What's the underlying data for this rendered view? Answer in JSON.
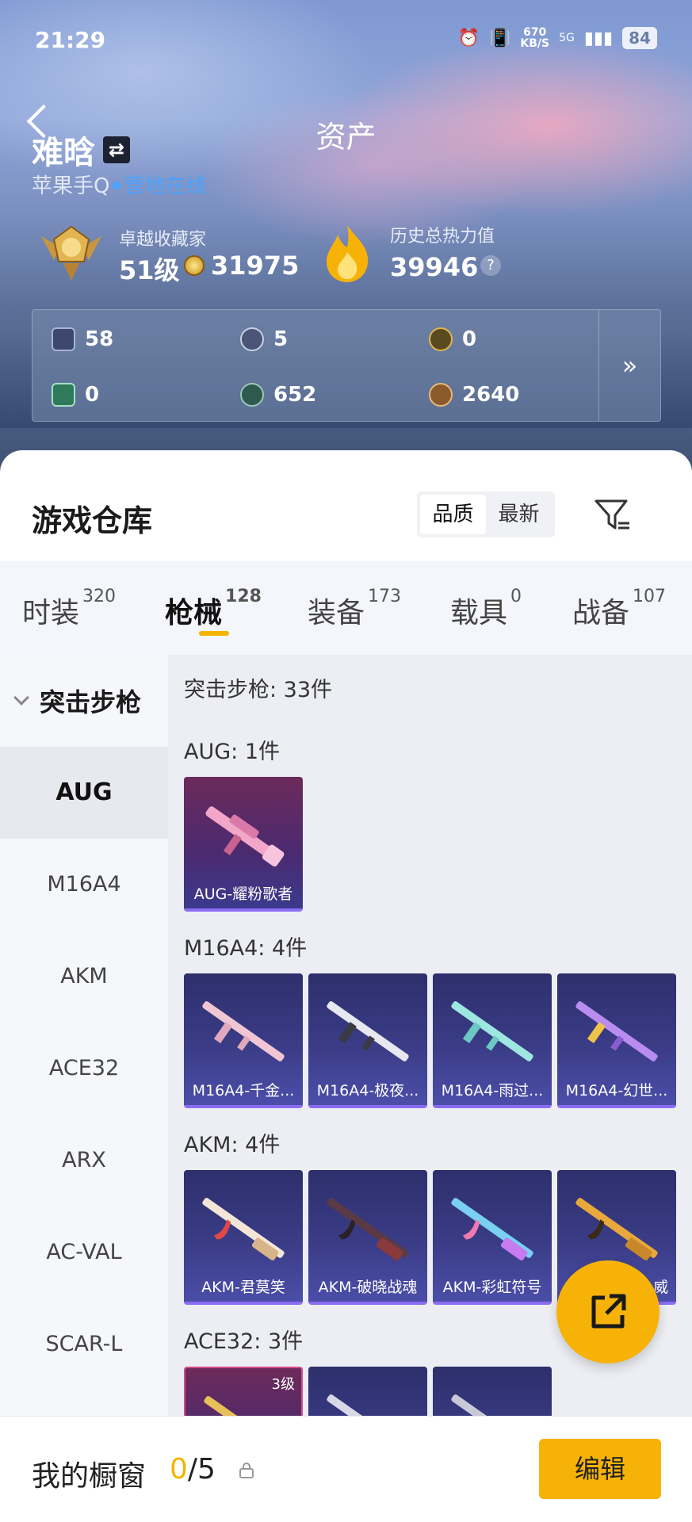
{
  "status_bar": {
    "time": "21:29",
    "speed": "670",
    "speed_unit": "KB/S",
    "network": "5G",
    "battery": "84"
  },
  "header": {
    "title": "资产",
    "username": "难晗",
    "platform": "苹果手Q",
    "status": "营地在线"
  },
  "rank": {
    "label": "卓越收藏家",
    "level": "51级",
    "coins": "31975"
  },
  "heat": {
    "label": "历史总热力值",
    "value": "39946"
  },
  "currencies": {
    "row1": [
      "58",
      "5",
      "0"
    ],
    "row2": [
      "0",
      "652",
      "2640"
    ]
  },
  "warehouse": {
    "title": "游戏仓库",
    "sort_quality": "品质",
    "sort_newest": "最新"
  },
  "tabs": [
    {
      "label": "时装",
      "count": "320"
    },
    {
      "label": "枪械",
      "count": "128"
    },
    {
      "label": "装备",
      "count": "173"
    },
    {
      "label": "载具",
      "count": "0"
    },
    {
      "label": "战备",
      "count": "107"
    }
  ],
  "side_nav": {
    "category": "突击步枪",
    "items": [
      "AUG",
      "M16A4",
      "AKM",
      "ACE32",
      "ARX",
      "AC-VAL",
      "SCAR-L"
    ]
  },
  "content": {
    "summary": "突击步枪: 33件",
    "groups": [
      {
        "title": "AUG: 1件",
        "items": [
          "AUG-耀粉歌者"
        ]
      },
      {
        "title": "M16A4: 4件",
        "items": [
          "M16A4-千金...",
          "M16A4-极夜...",
          "M16A4-雨过...",
          "M16A4-幻世..."
        ]
      },
      {
        "title": "AKM: 4件",
        "items": [
          "AKM-君莫笑",
          "AKM-破晓战魂",
          "AKM-彩虹符号",
          "威"
        ]
      },
      {
        "title": "ACE32: 3件",
        "items": [
          "3级"
        ]
      }
    ]
  },
  "bottom_bar": {
    "label": "我的橱窗",
    "count_current": "0",
    "count_total": "/5",
    "edit": "编辑"
  },
  "colors": {
    "accent": "#f7b208",
    "link": "#4aa3ff",
    "card": "#3a3c86"
  }
}
